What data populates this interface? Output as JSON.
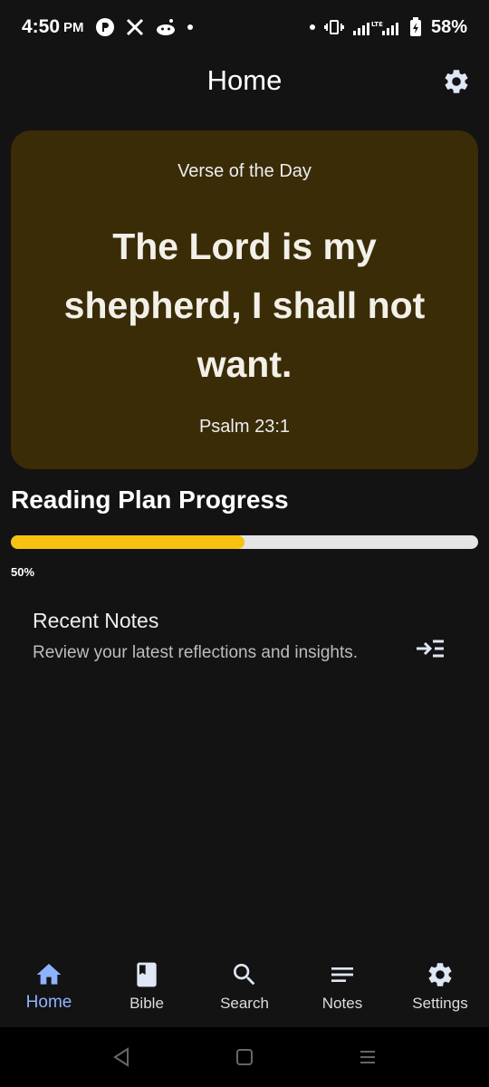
{
  "status_bar": {
    "time": "4:50",
    "ampm": "PM",
    "battery": "58%"
  },
  "app_bar": {
    "title": "Home"
  },
  "verse_card": {
    "label": "Verse of the Day",
    "verse": "The Lord is my shepherd, I shall not want.",
    "reference": "Psalm 23:1",
    "background": "#3a2c07"
  },
  "reading_plan": {
    "title": "Reading Plan Progress",
    "progress": 0.5,
    "progress_label": "50%",
    "accent": "#f7c210"
  },
  "recent_notes": {
    "title": "Recent Notes",
    "subtitle": "Review your latest reflections and insights.",
    "icon": "arrow-into-list-icon"
  },
  "bottom_nav": {
    "items": [
      {
        "label": "Home",
        "icon": "home-icon",
        "active": true
      },
      {
        "label": "Bible",
        "icon": "book-icon",
        "active": false
      },
      {
        "label": "Search",
        "icon": "search-icon",
        "active": false
      },
      {
        "label": "Notes",
        "icon": "notes-icon",
        "active": false
      },
      {
        "label": "Settings",
        "icon": "gear-icon",
        "active": false
      }
    ],
    "active_color": "#8fb2ff"
  }
}
